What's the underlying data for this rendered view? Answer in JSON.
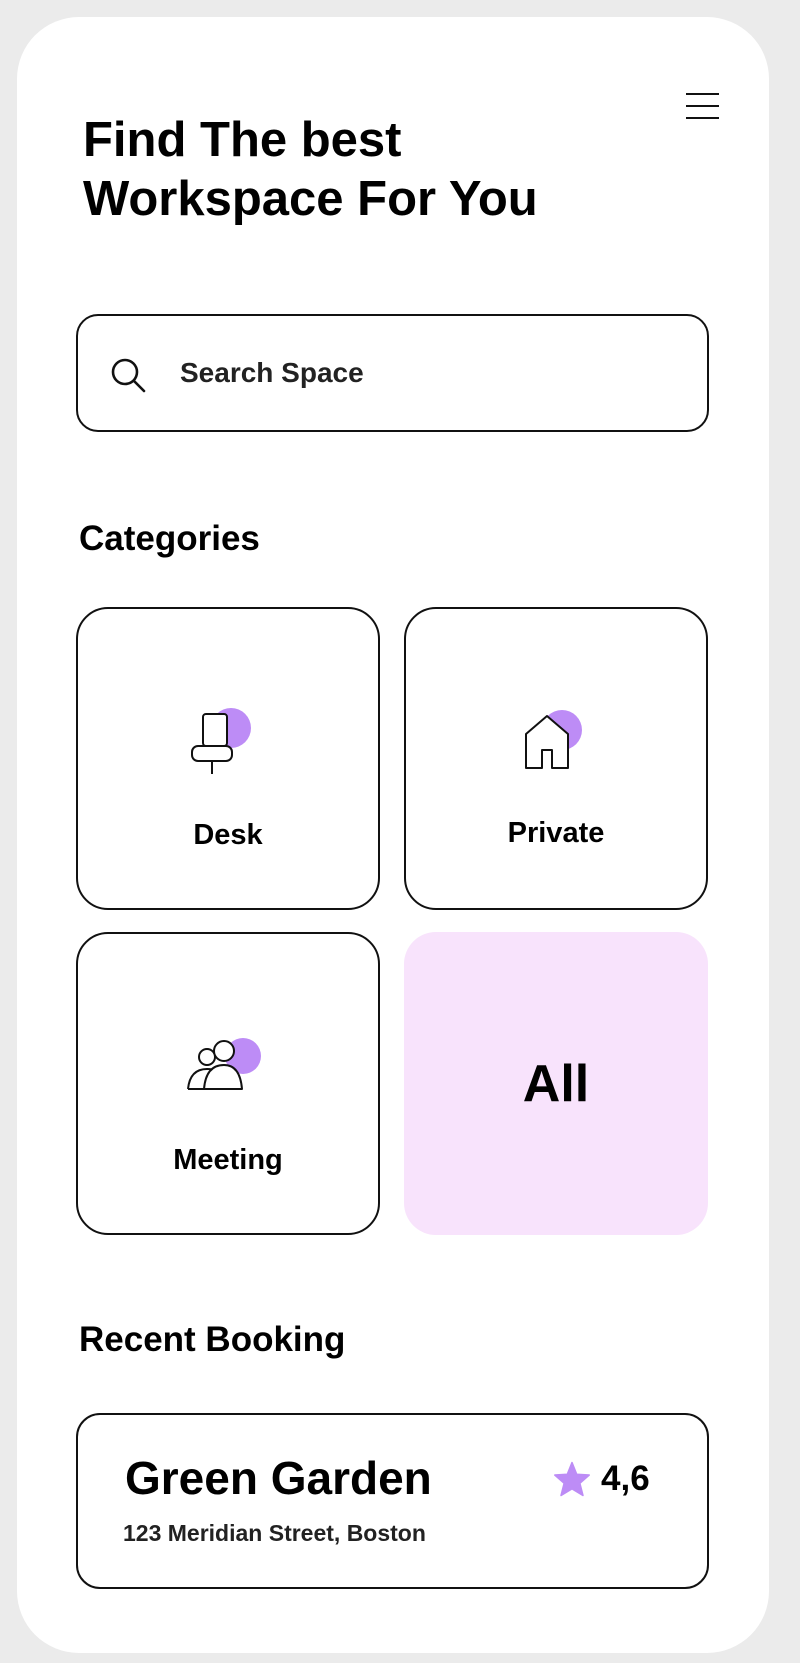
{
  "header": {
    "title": "Find The best\nWorkspace For You"
  },
  "search": {
    "placeholder": "Search Space"
  },
  "categories": {
    "title": "Categories",
    "items": [
      {
        "label": "Desk",
        "icon": "desk-chair-icon"
      },
      {
        "label": "Private",
        "icon": "house-icon"
      },
      {
        "label": "Meeting",
        "icon": "people-icon"
      },
      {
        "label": "All"
      }
    ]
  },
  "recent_booking": {
    "title": "Recent Booking",
    "name": "Green Garden",
    "address": "123 Meridian Street, Boston",
    "rating": "4,6"
  },
  "colors": {
    "accent": "#bd8cf6",
    "all_bg": "#f8e3fc"
  }
}
